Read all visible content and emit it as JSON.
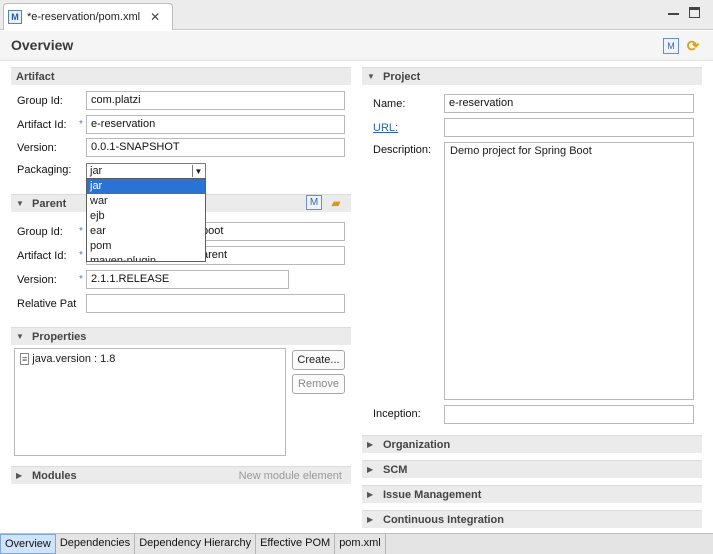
{
  "tab": {
    "title": "*e-reservation/pom.xml",
    "file_icon": "M"
  },
  "header": {
    "title": "Overview"
  },
  "artifact": {
    "title": "Artifact",
    "group_id_label": "Group Id:",
    "group_id": "com.platzi",
    "artifact_id_label": "Artifact Id:",
    "artifact_id": "e-reservation",
    "version_label": "Version:",
    "version": "0.0.1-SNAPSHOT",
    "packaging_label": "Packaging:",
    "packaging": "jar",
    "packaging_options": [
      "jar",
      "war",
      "ejb",
      "ear",
      "pom",
      "maven-plugin"
    ]
  },
  "parent": {
    "title": "Parent",
    "group_id_label": "Group Id:",
    "group_id_visible": "boot",
    "artifact_id_label": "Artifact Id:",
    "artifact_id_visible": "arent",
    "version_label": "Version:",
    "version": "2.1.1.RELEASE",
    "relative_path_label": "Relative Pat",
    "relative_path": ""
  },
  "properties": {
    "title": "Properties",
    "items": [
      "java.version : 1.8"
    ],
    "create_label": "Create...",
    "remove_label": "Remove"
  },
  "modules": {
    "title": "Modules",
    "new_module_label": "New module element"
  },
  "project": {
    "title": "Project",
    "name_label": "Name:",
    "name": "e-reservation",
    "url_label": "URL:",
    "url": "",
    "description_label": "Description:",
    "description": "Demo project for Spring Boot",
    "inception_label": "Inception:",
    "inception": ""
  },
  "collapsed_sections": [
    "Organization",
    "SCM",
    "Issue Management",
    "Continuous Integration"
  ],
  "bottom_tabs": [
    "Overview",
    "Dependencies",
    "Dependency Hierarchy",
    "Effective POM",
    "pom.xml"
  ],
  "colors": {
    "selection": "#2a72d4",
    "link": "#2a64b0",
    "active_tab": "#cfe3fb"
  }
}
